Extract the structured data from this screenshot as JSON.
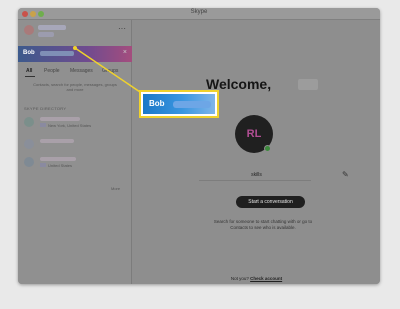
{
  "window": {
    "title": "Skype"
  },
  "account": {
    "more_label": "···"
  },
  "search": {
    "query": "Bob",
    "clear_label": "×"
  },
  "tabs": [
    {
      "label": "All"
    },
    {
      "label": "People"
    },
    {
      "label": "Messages"
    },
    {
      "label": "Groups"
    }
  ],
  "search_hint": "Contacts, search for people, messages, groups and more",
  "directory": {
    "heading": "SKYPE DIRECTORY",
    "results": [
      {
        "location": "New York, United States"
      },
      {
        "location": ""
      },
      {
        "location": "United States"
      }
    ],
    "more_label": "More"
  },
  "main": {
    "welcome": "Welcome,",
    "avatar_initials": "RL",
    "username": "skills",
    "start_button": "Start a conversation",
    "info": "Search for someone to start chatting with or go to Contacts to see who is available.",
    "footer_prefix": "Not you?",
    "footer_link": "Check account"
  },
  "callout": {
    "text": "Bob"
  },
  "colors": {
    "highlight": "#f0d22c",
    "presence": "#3c8a3c",
    "accent_gradient_start": "#1a78c8"
  }
}
